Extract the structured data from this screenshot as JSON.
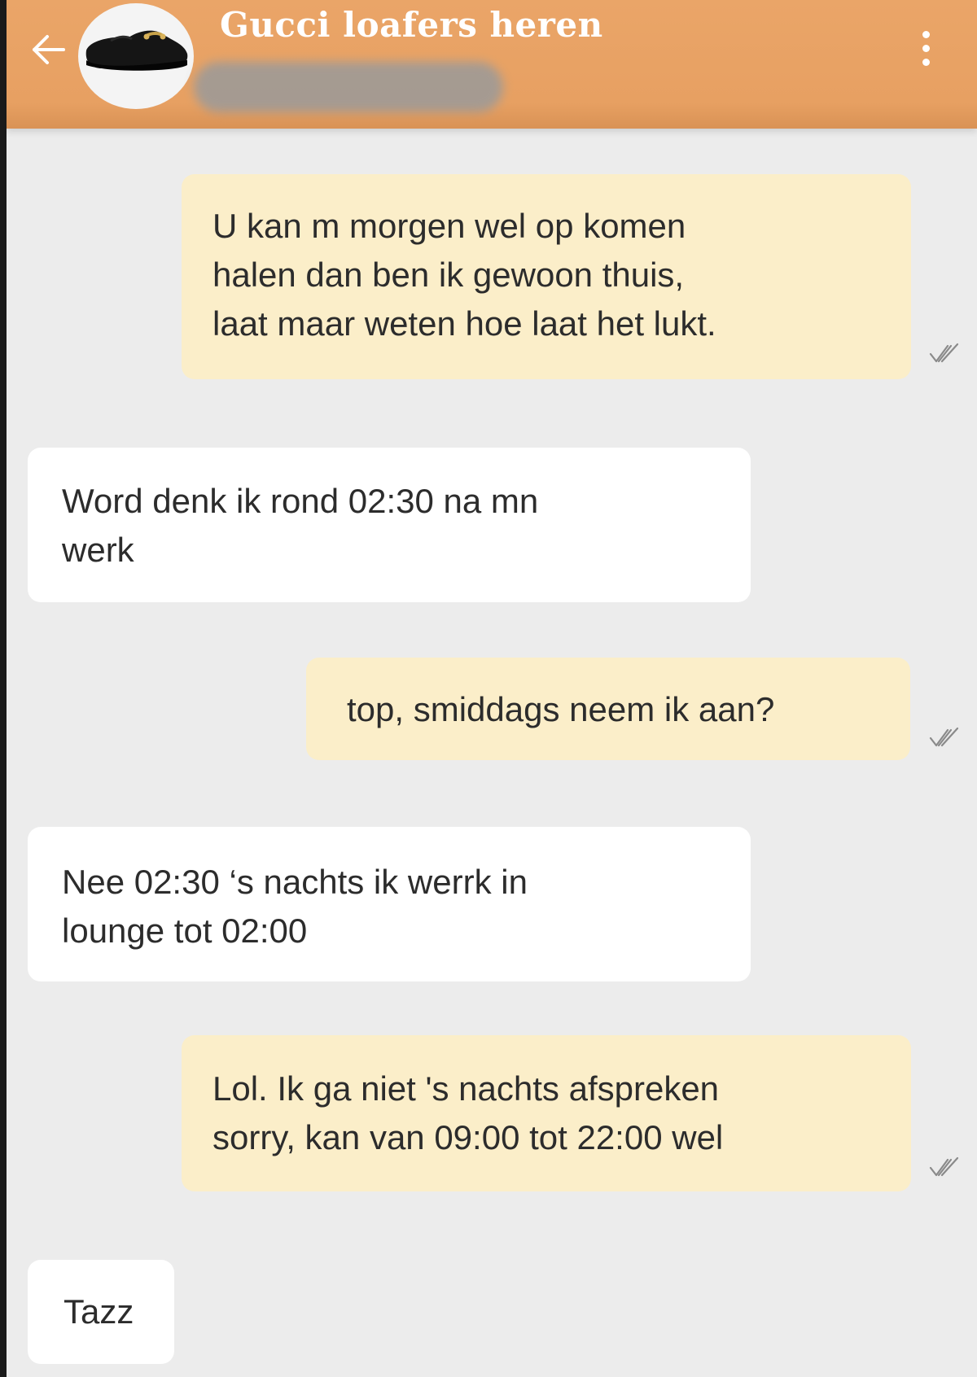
{
  "header": {
    "title": "Gucci loafers heren",
    "back_icon": "arrow-left-icon",
    "menu_icon": "more-vertical-icon",
    "avatar_image": "black loafer shoe with gold horsebit",
    "header_color": "#e9a365"
  },
  "messages": [
    {
      "direction": "sent",
      "text": "U kan m morgen wel op komen\nhalen dan ben ik gewoon thuis,\nlaat maar weten hoe laat het lukt.",
      "status_icon": "double-check-icon"
    },
    {
      "direction": "received",
      "text": "Word denk ik rond 02:30 na mn\nwerk"
    },
    {
      "direction": "sent",
      "text": "top, smiddags neem ik aan?",
      "status_icon": "double-check-icon"
    },
    {
      "direction": "received",
      "text": "Nee 02:30 ‘s nachts ik werrk in\nlounge tot 02:00"
    },
    {
      "direction": "sent",
      "text": "Lol. Ik ga niet 's nachts afspreken\nsorry, kan van 09:00 tot 22:00 wel",
      "status_icon": "double-check-icon"
    },
    {
      "direction": "received",
      "text": "Tazz"
    }
  ],
  "colors": {
    "sent_bubble": "#fbeec9",
    "received_bubble": "#ffffff",
    "chat_background": "#ececec"
  }
}
